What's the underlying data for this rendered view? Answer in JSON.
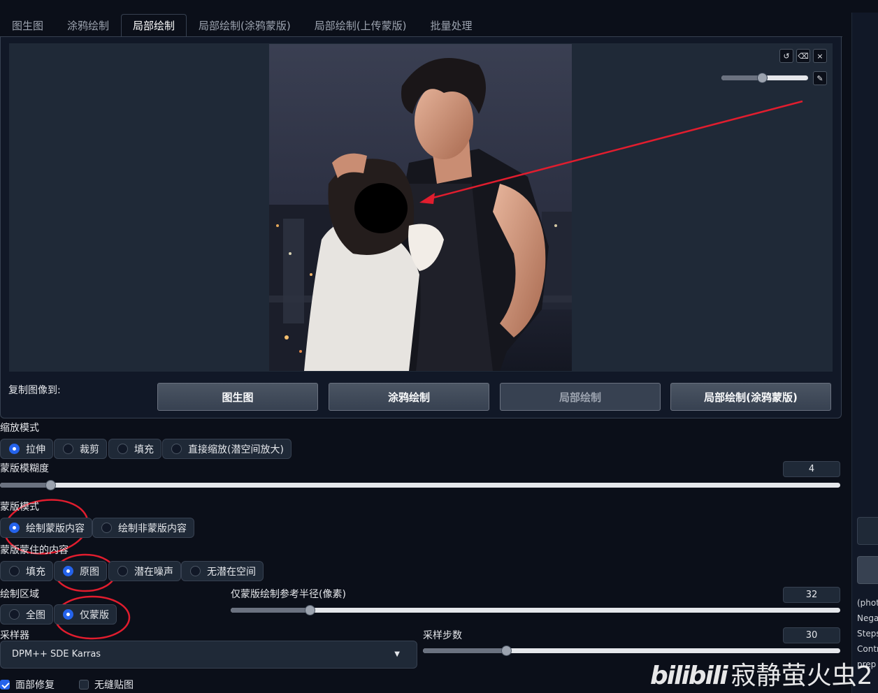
{
  "tabs": [
    "图生图",
    "涂鸦绘制",
    "局部绘制",
    "局部绘制(涂鸦蒙版)",
    "局部绘制(上传蒙版)",
    "批量处理"
  ],
  "active_tab_index": 2,
  "image_tools": {
    "undo_icon": "↺",
    "eraser_icon": "⌫",
    "close_icon": "×",
    "brush_icon": "✎",
    "brush_size_fraction": 0.45
  },
  "copy_to": {
    "label": "复制图像到:",
    "buttons": [
      "图生图",
      "涂鸦绘制",
      "局部绘制",
      "局部绘制(涂鸦蒙版)"
    ]
  },
  "resize_mode": {
    "label": "缩放模式",
    "options": [
      "拉伸",
      "裁剪",
      "填充",
      "直接缩放(潜空间放大)"
    ],
    "selected": 0
  },
  "mask_blur": {
    "label": "蒙版模糊度",
    "value": "4",
    "fraction": 0.06
  },
  "mask_mode": {
    "label": "蒙版模式",
    "options": [
      "绘制蒙版内容",
      "绘制非蒙版内容"
    ],
    "selected": 0
  },
  "masked_content": {
    "label": "蒙版蒙住的内容",
    "options": [
      "填充",
      "原图",
      "潜在噪声",
      "无潜在空间"
    ],
    "selected": 1
  },
  "inpaint_area": {
    "label": "绘制区域",
    "options": [
      "全图",
      "仅蒙版"
    ],
    "selected": 1
  },
  "only_masked_padding": {
    "label": "仅蒙版绘制参考半径(像素)",
    "value": "32",
    "fraction": 0.13
  },
  "sampler": {
    "label": "采样器",
    "value": "DPM++ SDE Karras"
  },
  "steps": {
    "label": "采样步数",
    "value": "30",
    "fraction": 0.2
  },
  "checkboxes": [
    {
      "label": "面部修复",
      "checked": true
    },
    {
      "label": "无缝贴图",
      "checked": false
    }
  ],
  "right_panel_text": [
    "(phot",
    "Nega",
    "Steps",
    "Contr",
    "prep"
  ],
  "watermark": {
    "logo": "bilibili",
    "text": "寂静萤火虫2"
  },
  "colors": {
    "accent": "#2563eb",
    "annotation": "#e11d2e",
    "background": "#0b0f19"
  }
}
